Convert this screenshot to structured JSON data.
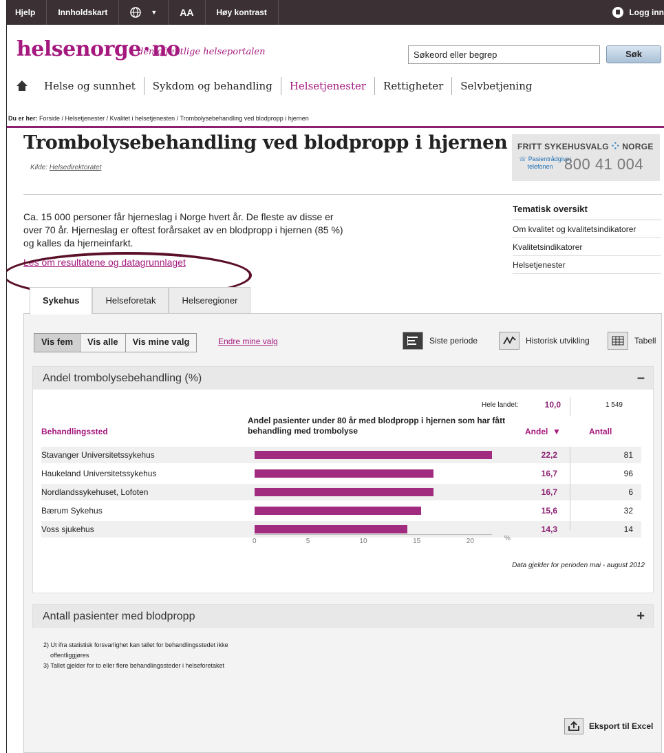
{
  "topbar": {
    "help": "Hjelp",
    "contents": "Innholdskart",
    "aa": "AA",
    "contrast": "Høy kontrast",
    "login": "Logg inn"
  },
  "header": {
    "logo_main": "helsenorge",
    "logo_tld": "no",
    "tagline": "den offentlige helseportalen",
    "search_placeholder": "Søkeord eller begrep",
    "search_button": "Søk"
  },
  "nav": [
    "Helse og sunnhet",
    "Sykdom og behandling",
    "Helsetjenester",
    "Rettigheter",
    "Selvbetjening"
  ],
  "breadcrumb": {
    "prefix": "Du er her:",
    "path": "Forside / Helsetjenester / Kvalitet i helsetjenesten / Trombolysebehandling ved blodpropp i hjernen"
  },
  "page": {
    "title": "Trombolysebehandling ved blodpropp i hjernen",
    "source_label": "Kilde:",
    "source_link": "Helsedirektoratet",
    "intro": "Ca. 15 000 personer får hjerneslag i Norge hvert år. De fleste av disse er over 70 år. Hjerneslag er oftest forårsaket av en blodpropp i hjernen (85 %) og kalles da hjerneinfarkt.",
    "read_link": "Les om resultatene og datagrunnlaget"
  },
  "promo": {
    "title": "FRITT SYKEHUSVALG",
    "country": "NORGE",
    "line1": "Pasientrådgiver",
    "line2": "telefonen",
    "phone": "800 41 004"
  },
  "tema": {
    "heading": "Tematisk oversikt",
    "items": [
      "Om kvalitet og kvalitetsindikatorer",
      "Kvalitetsindikatorer",
      "Helsetjenester"
    ]
  },
  "tabs": [
    "Sykehus",
    "Helseforetak",
    "Helseregioner"
  ],
  "controls": {
    "toggles": [
      "Vis fem",
      "Vis alle",
      "Vis mine valg"
    ],
    "edit": "Endre mine valg",
    "view1": "Siste periode",
    "view2": "Historisk utvikling",
    "view3": "Tabell"
  },
  "section1": {
    "title": "Andel trombolysebehandling (%)",
    "toggle": "–"
  },
  "section2": {
    "title": "Antall pasienter med blodpropp",
    "toggle": "+"
  },
  "chart_data": {
    "type": "bar",
    "orientation": "horizontal",
    "title": "Andel pasienter under 80 år med blodpropp i hjernen som har fått behandling med trombolyse",
    "col_place": "Behandlingssted",
    "col_andel": "Andel",
    "col_antall": "Antall",
    "national_label": "Hele landet:",
    "national_andel": "10,0",
    "national_antall": "1 549",
    "categories": [
      "Stavanger Universitetssykehus",
      "Haukeland Universitetssykehus",
      "Nordlandssykehuset, Lofoten",
      "Bærum Sykehus",
      "Voss sjukehus"
    ],
    "values": [
      22.2,
      16.7,
      16.7,
      15.6,
      14.3
    ],
    "value_labels": [
      "22,2",
      "16,7",
      "16,7",
      "15,6",
      "14,3"
    ],
    "antall": [
      "81",
      "96",
      "6",
      "32",
      "14"
    ],
    "xticks": [
      "0",
      "5",
      "10",
      "15",
      "20"
    ],
    "xunit": "%",
    "xlim": [
      0,
      22.2
    ],
    "bar_color": "#a02b7f",
    "note": "Data gjelder for perioden mai - august 2012"
  },
  "footnotes": [
    "2) Ut ifra statistisk forsvarlighet kan tallet for behandlingsstedet ikke",
    "offentliggjøres",
    "3) Tallet gjelder for to eller flere behandlingssteder i helseforetaket"
  ],
  "export": "Eksport til Excel"
}
